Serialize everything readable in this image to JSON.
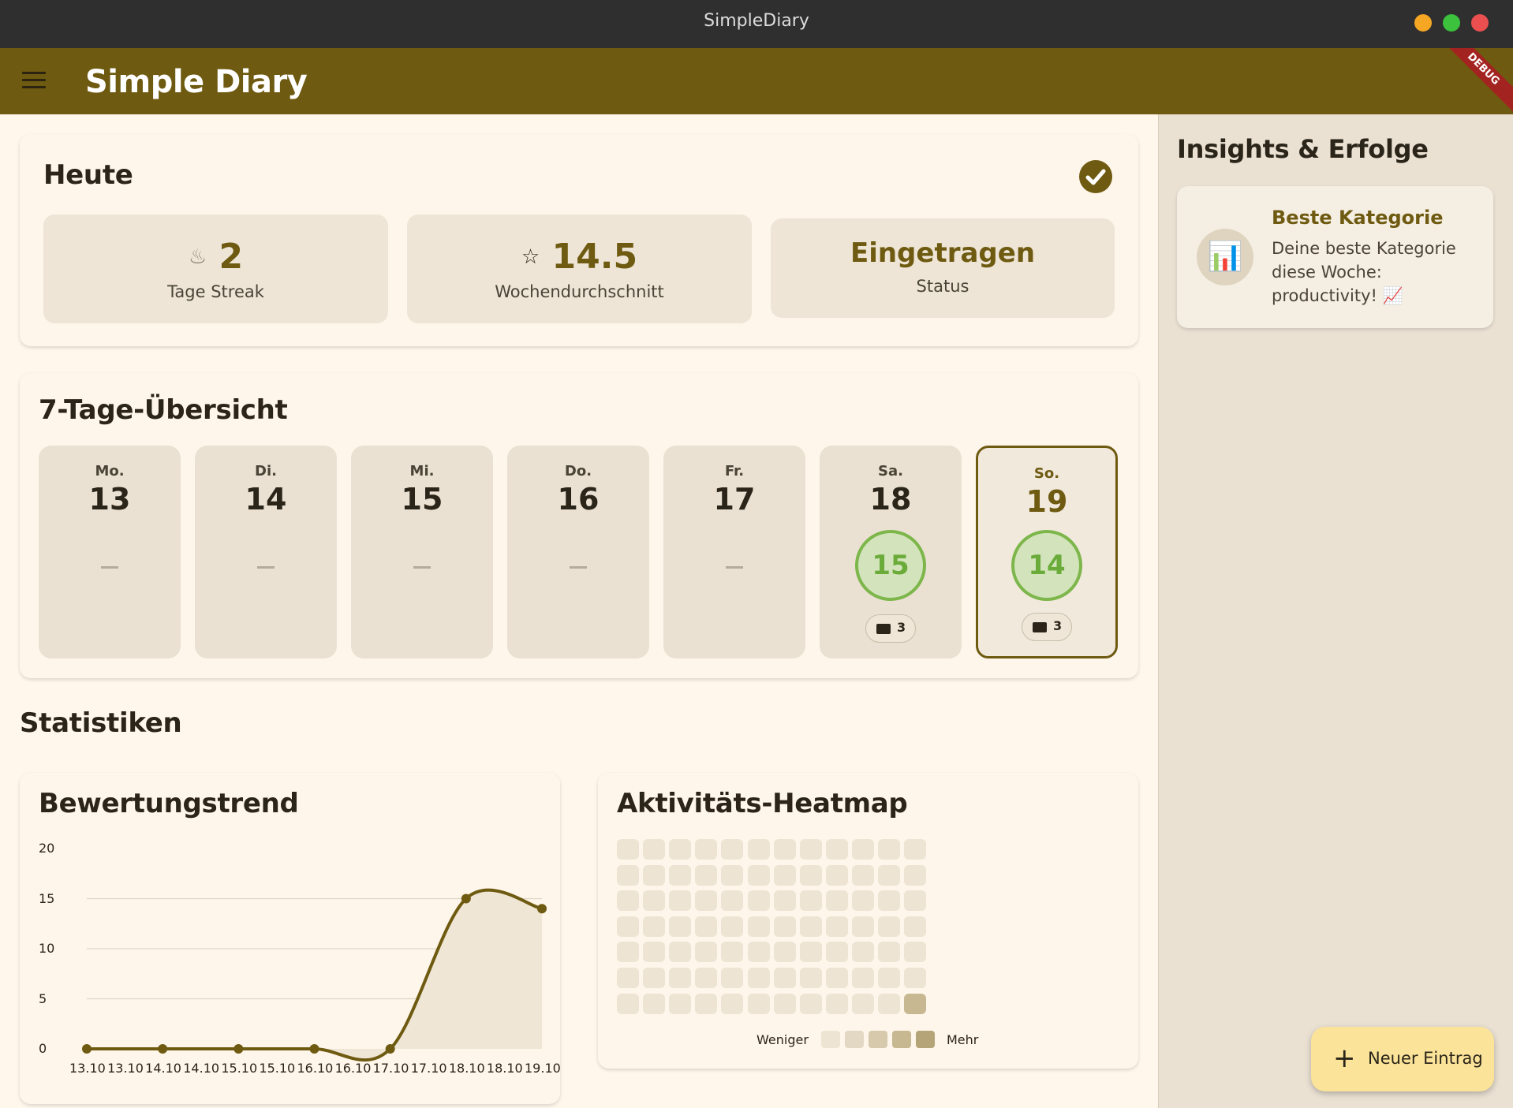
{
  "window": {
    "title": "SimpleDiary"
  },
  "appbar": {
    "title": "Simple Diary",
    "debug_label": "DEBUG"
  },
  "today": {
    "title": "Heute",
    "streak": {
      "icon": "fire-icon",
      "value": "2",
      "label": "Tage Streak"
    },
    "average": {
      "icon": "star-icon",
      "value": "14.5",
      "label": "Wochendurchschnitt"
    },
    "status": {
      "value": "Eingetragen",
      "label": "Status"
    }
  },
  "week": {
    "title": "7-Tage-Übersicht",
    "days": [
      {
        "weekday": "Mo.",
        "date": "13"
      },
      {
        "weekday": "Di.",
        "date": "14"
      },
      {
        "weekday": "Mi.",
        "date": "15"
      },
      {
        "weekday": "Do.",
        "date": "16"
      },
      {
        "weekday": "Fr.",
        "date": "17"
      },
      {
        "weekday": "Sa.",
        "date": "18",
        "score": "15",
        "tags": "3"
      },
      {
        "weekday": "So.",
        "date": "19",
        "score": "14",
        "tags": "3"
      }
    ]
  },
  "stats": {
    "title": "Statistiken"
  },
  "chart_data": {
    "type": "line",
    "title": "Bewertungstrend",
    "x": [
      "13.10",
      "14.10",
      "15.10",
      "16.10",
      "17.10",
      "18.10",
      "19.10"
    ],
    "x_tick_labels": [
      "13.10",
      "13.10",
      "14.10",
      "14.10",
      "15.10",
      "15.10",
      "16.10",
      "16.10",
      "17.10",
      "17.10",
      "18.10",
      "18.10",
      "19.10"
    ],
    "values": [
      0,
      0,
      0,
      0,
      0,
      15,
      14
    ],
    "y_ticks": [
      0,
      5,
      10,
      15,
      20
    ],
    "ylim": [
      0,
      20
    ],
    "grid": true,
    "line_color": "#6e5a10",
    "fill_color": "#efe6d6"
  },
  "heatmap": {
    "title": "Aktivitäts-Heatmap",
    "rows": 7,
    "cols": 12,
    "active_cells": [
      {
        "row": 6,
        "col": 11,
        "level": 4
      }
    ],
    "legend_less": "Weniger",
    "legend_more": "Mehr",
    "levels": [
      "#ede4d4",
      "#e3d8c3",
      "#d6c9ac",
      "#c8b891",
      "#b4a478"
    ]
  },
  "sidebar": {
    "title": "Insights & Erfolge",
    "insight": {
      "icon": "bar-chart-icon",
      "title": "Beste Kategorie",
      "line1": "Deine beste Kategorie",
      "line2": "diese Woche:",
      "line3": "productivity! 📈"
    }
  },
  "fab": {
    "label": "Neuer Eintrag"
  },
  "colors": {
    "brand": "#6e5a10",
    "success": "#7db64b",
    "fab": "#fbe49a"
  }
}
